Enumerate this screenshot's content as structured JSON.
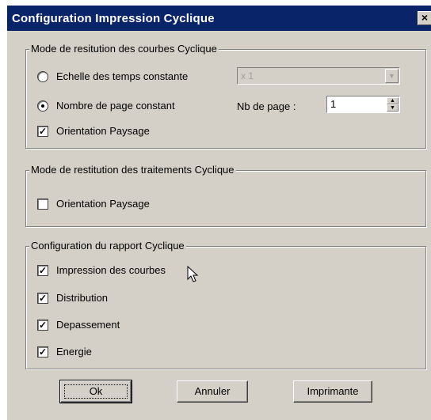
{
  "window": {
    "title": "Configuration Impression Cyclique",
    "close_glyph": "×"
  },
  "group_courbes": {
    "title": "Mode de resitution des courbes Cyclique",
    "radio_echelle": {
      "label": "Echelle des temps constante",
      "selected": false
    },
    "radio_nbpage": {
      "label": "Nombre de page constant",
      "selected": true
    },
    "echelle_combo": {
      "value": "x 1",
      "enabled": false
    },
    "nb_page_label": "Nb de page :",
    "nb_page_value": "1",
    "orientation": {
      "label": "Orientation Paysage",
      "checked": true
    }
  },
  "group_traitements": {
    "title": "Mode de restitution des traitements Cyclique",
    "orientation": {
      "label": "Orientation Paysage",
      "checked": false
    }
  },
  "group_rapport": {
    "title": "Configuration du rapport Cyclique",
    "items": [
      {
        "label": "Impression des courbes",
        "checked": true
      },
      {
        "label": "Distribution",
        "checked": true
      },
      {
        "label": "Depassement",
        "checked": true
      },
      {
        "label": "Energie",
        "checked": true
      }
    ]
  },
  "buttons": {
    "ok": "Ok",
    "cancel": "Annuler",
    "printer": "Imprimante"
  },
  "check_glyph": "✓",
  "icons": {
    "close": "close-icon",
    "cursor": "mouse-pointer-icon",
    "spin_up": "spin-up-icon",
    "spin_down": "spin-down-icon",
    "dropdown": "dropdown-arrow-icon"
  }
}
